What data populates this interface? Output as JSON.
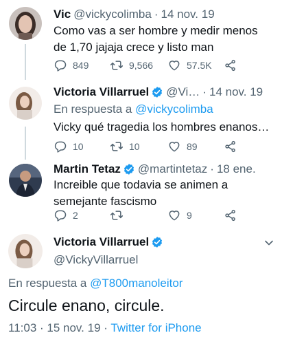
{
  "colors": {
    "accent": "#1d9bf0",
    "secondary_text": "#536471",
    "primary_text": "#0f1419",
    "thread_line": "#cfd9de"
  },
  "tweets": [
    {
      "name": "Vic",
      "handle": "@vickycolimba",
      "time": "14 nov. 19",
      "text": "Como vas a ser hombre y medir menos de 1,70 jajaja crece y listo man",
      "replies": "849",
      "retweets": "9,566",
      "likes": "57.5K"
    },
    {
      "name": "Victoria Villarruel",
      "handle": "@Vi…",
      "time": "14 nov. 19",
      "reply_prefix": "En respuesta a",
      "reply_to": "@vickycolimba",
      "text": "Vicky qué tragedia los hombres enanos…",
      "replies": "10",
      "retweets": "10",
      "likes": "89"
    },
    {
      "name": "Martin Tetaz",
      "handle": "@martintetaz",
      "time": "18 ene.",
      "text": "Increible que todavia se animen a semejante fascismo",
      "replies": "2",
      "retweets": "",
      "likes": "9"
    }
  ],
  "detail": {
    "name": "Victoria Villarruel",
    "handle": "@VickyVillarruel",
    "reply_prefix": "En respuesta a",
    "reply_to": "@T800manoleitor",
    "text": "Circule enano, circule.",
    "timestamp": "11:03 · 15 nov. 19 ·",
    "source": "Twitter for iPhone"
  },
  "icons": [
    "reply-icon",
    "retweet-icon",
    "like-icon",
    "share-icon",
    "verified-icon",
    "more-caret-icon"
  ]
}
